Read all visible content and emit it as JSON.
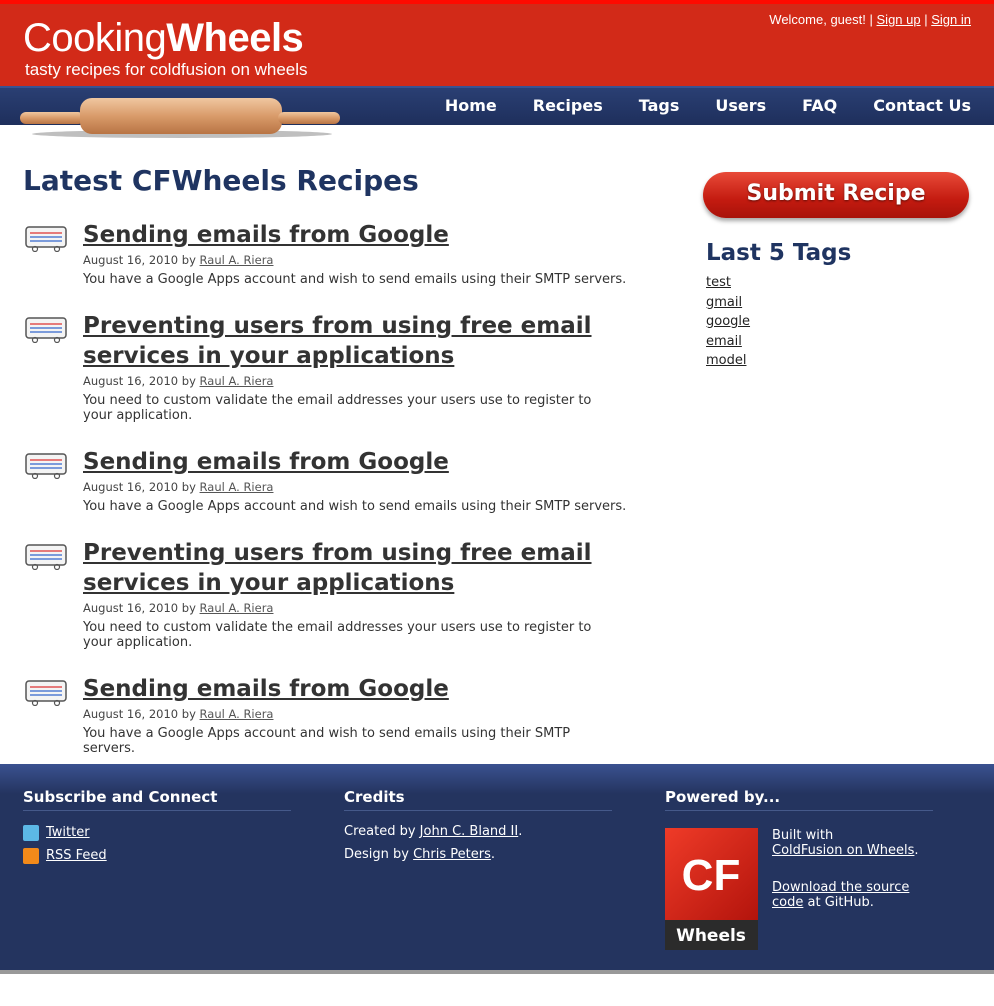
{
  "header": {
    "logo_light": "Cooking",
    "logo_bold": "Wheels",
    "tagline": "tasty recipes for coldfusion on wheels",
    "welcome": "Welcome, guest!",
    "signup": "Sign up",
    "signin": "Sign in",
    "separator": "|"
  },
  "nav": {
    "items": [
      {
        "label": "Home"
      },
      {
        "label": "Recipes"
      },
      {
        "label": "Tags"
      },
      {
        "label": "Users"
      },
      {
        "label": "FAQ"
      },
      {
        "label": "Contact Us"
      }
    ]
  },
  "main": {
    "title": "Latest CFWheels Recipes",
    "by": "by",
    "recipes": [
      {
        "title": "Sending emails from Google",
        "date": "August 16, 2010",
        "author": "Raul A. Riera",
        "desc": "You have a Google Apps account and wish to send emails using their SMTP servers."
      },
      {
        "title": "Preventing users from using free email services in your applications",
        "date": "August 16, 2010",
        "author": "Raul A. Riera",
        "desc": "You need to custom validate the email addresses your users use to register to your application."
      },
      {
        "title": "Sending emails from Google",
        "date": "August 16, 2010",
        "author": "Raul A. Riera",
        "desc": "You have a Google Apps account and wish to send emails using their SMTP servers."
      },
      {
        "title": "Preventing users from using free email services in your applications",
        "date": "August 16, 2010",
        "author": "Raul A. Riera",
        "desc": "You need to custom validate the email addresses your users use to register to your application."
      },
      {
        "title": "Sending emails from Google",
        "date": "August 16, 2010",
        "author": "Raul A. Riera",
        "desc": "You have a Google Apps account and wish to send emails using their SMTP servers."
      }
    ]
  },
  "sidebar": {
    "submit_label": "Submit Recipe",
    "tags_title": "Last 5 Tags",
    "tags": [
      "test",
      "gmail",
      "google",
      "email",
      "model"
    ]
  },
  "footer": {
    "subscribe": {
      "title": "Subscribe and Connect",
      "twitter": "Twitter",
      "rss": "RSS Feed"
    },
    "credits": {
      "title": "Credits",
      "created_by": "Created by",
      "creator": "John C. Bland II",
      "design_by": "Design by",
      "designer": "Chris Peters",
      "period": "."
    },
    "powered": {
      "title": "Powered by...",
      "logo_cf": "CF",
      "logo_wheels": "Wheels",
      "built_with": "Built with",
      "framework": "ColdFusion on Wheels",
      "download": "Download the source code",
      "at_github": "at GitHub."
    }
  },
  "colors": {
    "header_red": "#d22a18",
    "nav_blue": "#24345f",
    "title_blue": "#1f3461"
  }
}
